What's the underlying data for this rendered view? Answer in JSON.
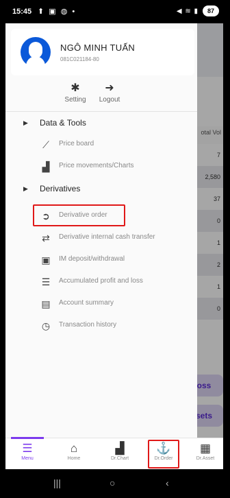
{
  "status_bar": {
    "time": "15:45",
    "icons_left": "⬆ ▣ ◍ •",
    "icons_right": "◀ ≋ ▮",
    "battery": "87"
  },
  "background": {
    "column_header": "otal Vol",
    "values": [
      "7",
      "2,580",
      "37",
      "0",
      "1",
      "2",
      "1",
      "0"
    ],
    "btn_loss": "oss",
    "btn_assets": "sets"
  },
  "profile": {
    "name": "NGÔ MINH TUẤN",
    "id": "081C021184-80"
  },
  "actions": {
    "setting": "Setting",
    "logout": "Logout"
  },
  "menu": {
    "data_tools": {
      "label": "Data & Tools",
      "items": [
        {
          "label": "Price board",
          "icon": "chart-line-icon"
        },
        {
          "label": "Price movements/Charts",
          "icon": "bar-chart-icon"
        }
      ]
    },
    "derivatives": {
      "label": "Derivatives",
      "items": [
        {
          "label": "Derivative order",
          "icon": "arrow-circle-icon"
        },
        {
          "label": "Derivative internal cash transfer",
          "icon": "transfer-icon"
        },
        {
          "label": "IM deposit/withdrawal",
          "icon": "deposit-icon"
        },
        {
          "label": "Accumulated profit and loss",
          "icon": "profit-loss-icon"
        },
        {
          "label": "Account summary",
          "icon": "document-icon"
        },
        {
          "label": "Transaction history",
          "icon": "clock-icon"
        }
      ]
    }
  },
  "bottom_nav": [
    {
      "label": "Menu",
      "active": true
    },
    {
      "label": "Home"
    },
    {
      "label": "Dr.Chart"
    },
    {
      "label": "Dr.Order"
    },
    {
      "label": "Dr.Asset"
    }
  ],
  "colors": {
    "accent": "#7c3aed",
    "avatar": "#0b59d9",
    "highlight": "#e01818"
  }
}
